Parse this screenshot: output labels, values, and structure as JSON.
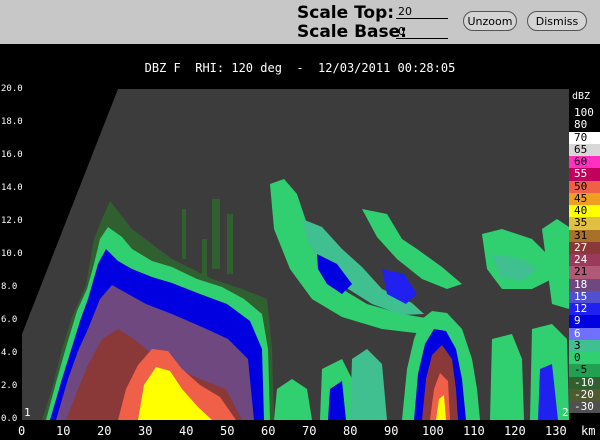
{
  "controls": {
    "scale_top_label": "Scale Top:",
    "scale_top_value": "20",
    "scale_base_label": "Scale Base:",
    "scale_base_value": "0",
    "unzoom_label": "Unzoom",
    "dismiss_label": "Dismiss"
  },
  "plot_title": "DBZ F  RHI: 120 deg  -  12/03/2011 00:28:05",
  "y_axis": {
    "ticks": [
      "20.0",
      "18.0",
      "16.0",
      "14.0",
      "12.0",
      "10.0",
      "8.0",
      "6.0",
      "4.0",
      "2.0",
      "0.0"
    ]
  },
  "x_axis": {
    "ticks": [
      "0",
      "10",
      "20",
      "30",
      "40",
      "50",
      "60",
      "70",
      "80",
      "90",
      "100",
      "110",
      "120",
      "130"
    ],
    "unit": "km"
  },
  "corner_labels": {
    "left": "1",
    "right": "2"
  },
  "legend": {
    "unit": "dBZ",
    "entries": [
      {
        "label": "100",
        "color": "#000000",
        "text_color": "#ffffff"
      },
      {
        "label": "80",
        "color": "#000000",
        "text_color": "#ffffff"
      },
      {
        "label": "70",
        "color": "#ffffff",
        "text_color": "#000000"
      },
      {
        "label": "65",
        "color": "#d8d8d8",
        "text_color": "#000000"
      },
      {
        "label": "60",
        "color": "#ff30c0",
        "text_color": "#000000"
      },
      {
        "label": "55",
        "color": "#c0005c",
        "text_color": "#ffffff"
      },
      {
        "label": "50",
        "color": "#f06048",
        "text_color": "#000000"
      },
      {
        "label": "45",
        "color": "#f0a020",
        "text_color": "#000000"
      },
      {
        "label": "40",
        "color": "#ffff00",
        "text_color": "#000000"
      },
      {
        "label": "35",
        "color": "#e0c040",
        "text_color": "#000000"
      },
      {
        "label": "31",
        "color": "#a87028",
        "text_color": "#000000"
      },
      {
        "label": "27",
        "color": "#8a3838",
        "text_color": "#ffffff"
      },
      {
        "label": "24",
        "color": "#9c3a5c",
        "text_color": "#ffffff"
      },
      {
        "label": "21",
        "color": "#b05a78",
        "text_color": "#000000"
      },
      {
        "label": "18",
        "color": "#704880",
        "text_color": "#ffffff"
      },
      {
        "label": "15",
        "color": "#5050d0",
        "text_color": "#ffffff"
      },
      {
        "label": "12",
        "color": "#2020f0",
        "text_color": "#ffffff"
      },
      {
        "label": "9",
        "color": "#0000e0",
        "text_color": "#ffffff"
      },
      {
        "label": "6",
        "color": "#7070ff",
        "text_color": "#ffffff"
      },
      {
        "label": "3",
        "color": "#40c090",
        "text_color": "#000000"
      },
      {
        "label": "0",
        "color": "#30d070",
        "text_color": "#000000"
      },
      {
        "label": "-5",
        "color": "#20a050",
        "text_color": "#000000"
      },
      {
        "label": "-10",
        "color": "#306030",
        "text_color": "#ffffff"
      },
      {
        "label": "-20",
        "color": "#505a30",
        "text_color": "#ffffff"
      },
      {
        "label": "-30",
        "color": "#505050",
        "text_color": "#ffffff"
      }
    ]
  }
}
